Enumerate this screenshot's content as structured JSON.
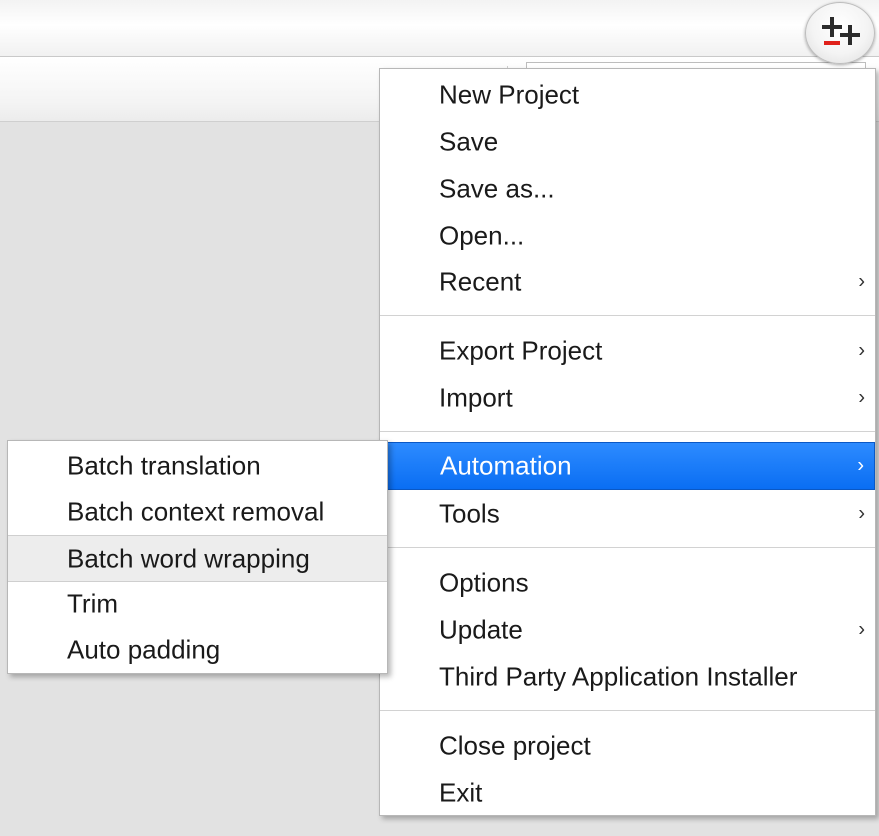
{
  "app_button": {
    "icon": "plus-minus-plus-icon",
    "accent_colors": {
      "dark": "#2b2b2b",
      "red": "#e0211b"
    }
  },
  "main_menu": {
    "items": [
      {
        "label": "New Project",
        "has_submenu": false
      },
      {
        "label": "Save",
        "has_submenu": false
      },
      {
        "label": "Save as...",
        "has_submenu": false
      },
      {
        "label": "Open...",
        "has_submenu": false
      },
      {
        "label": "Recent",
        "has_submenu": true
      },
      {
        "label": "Export Project",
        "has_submenu": true
      },
      {
        "label": "Import",
        "has_submenu": true
      },
      {
        "label": "Automation",
        "has_submenu": true,
        "highlighted": true
      },
      {
        "label": "Tools",
        "has_submenu": true
      },
      {
        "label": "Options",
        "has_submenu": false
      },
      {
        "label": "Update",
        "has_submenu": true
      },
      {
        "label": "Third Party Application Installer",
        "has_submenu": false
      },
      {
        "label": "Close project",
        "has_submenu": false
      },
      {
        "label": "Exit",
        "has_submenu": false
      }
    ],
    "arrow_glyph": "›",
    "highlight_color": "#1a7cff"
  },
  "sub_menu": {
    "parent": "Automation",
    "items": [
      {
        "label": "Batch translation"
      },
      {
        "label": "Batch context removal"
      },
      {
        "label": "Batch word wrapping",
        "hovered": true
      },
      {
        "label": "Trim"
      },
      {
        "label": "Auto padding"
      }
    ]
  }
}
